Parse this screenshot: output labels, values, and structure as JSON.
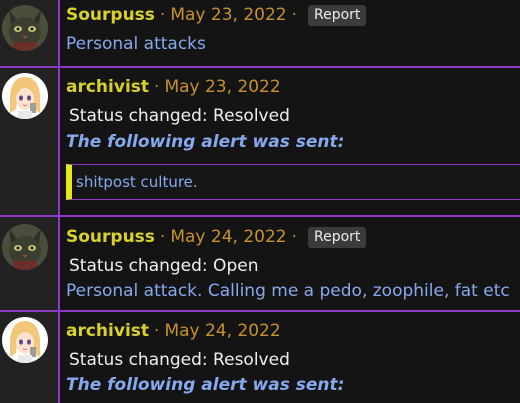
{
  "comments": [
    {
      "author": "Sourpuss",
      "separator": "·",
      "date": "May 23, 2022",
      "report_label": "Report",
      "avatar_icon": "cat-avatar-icon",
      "body": "Personal attacks"
    },
    {
      "author": "archivist",
      "separator": "·",
      "date": "May 23, 2022",
      "avatar_icon": "anime-avatar-icon",
      "status": "Status changed: Resolved",
      "alert_intro": "The following alert was sent:",
      "alert_text": "shitpost culture."
    },
    {
      "author": "Sourpuss",
      "separator": "·",
      "date": "May 24, 2022",
      "report_label": "Report",
      "avatar_icon": "cat-avatar-icon",
      "status": "Status changed: Open",
      "body": "Personal attack. Calling me a pedo, zoophile, fat etc"
    },
    {
      "author": "archivist",
      "separator": "·",
      "date": "May 24, 2022",
      "avatar_icon": "anime-avatar-icon",
      "status": "Status changed: Resolved",
      "alert_intro": "The following alert was sent:"
    }
  ],
  "colors": {
    "author": "#d7d12a",
    "date": "#c8912c",
    "accent_border": "#8e3ac8",
    "quote_bar": "#e3e81b",
    "text_blue": "#86a9ee",
    "report_bg": "#3b3b3b"
  }
}
